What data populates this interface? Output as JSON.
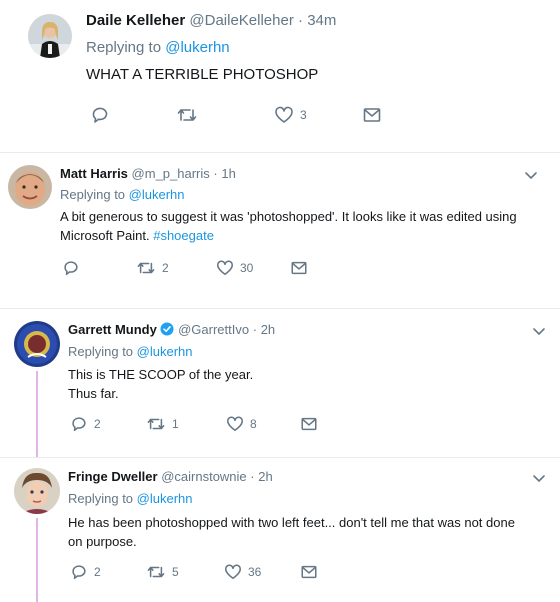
{
  "tweets": [
    {
      "name": "Daile Kelleher",
      "handle": "@DaileKelleher",
      "sep": "·",
      "time": "34m",
      "replying_prefix": "Replying to",
      "replying_to": "@lukerhn",
      "text": "WHAT A TERRIBLE PHOTOSHOP",
      "actions": {
        "reply": "",
        "retweet": "",
        "like": "3"
      }
    },
    {
      "name": "Matt Harris",
      "handle": "@m_p_harris",
      "sep": "·",
      "time": "1h",
      "replying_prefix": "Replying to",
      "replying_to": "@lukerhn",
      "text_line1": "A bit generous to suggest it was 'photoshopped'. It looks like it was edited using",
      "text_line2": "Microsoft Paint.",
      "hashtag": "#shoegate",
      "actions": {
        "reply": "",
        "retweet": "2",
        "like": "30"
      }
    },
    {
      "name": "Garrett Mundy",
      "handle": "@GarrettIvo",
      "sep": "·",
      "time": "2h",
      "replying_prefix": "Replying to",
      "replying_to": "@lukerhn",
      "text_line1": "This is THE SCOOP of the year.",
      "text_line2": "Thus far.",
      "actions": {
        "reply": "2",
        "retweet": "1",
        "like": "8"
      }
    },
    {
      "name": "Fringe Dweller",
      "handle": "@cairnstownie",
      "sep": "·",
      "time": "2h",
      "replying_prefix": "Replying to",
      "replying_to": "@lukerhn",
      "text_line1": "He has been photoshopped with two left feet... don't tell me that was not done",
      "text_line2": "on purpose.",
      "actions": {
        "reply": "2",
        "retweet": "5",
        "like": "36"
      }
    }
  ],
  "icons": {
    "reply": "reply-icon",
    "retweet": "retweet-icon",
    "like": "heart-icon",
    "dm": "envelope-icon",
    "caret": "chevron-down-icon",
    "verified": "verified-badge-icon"
  },
  "colors": {
    "link": "#1b95e0",
    "secondary_text": "#657786",
    "divider": "#e6ecf0",
    "thread_line": "#e1b3e6",
    "verified": "#1da1f2"
  }
}
